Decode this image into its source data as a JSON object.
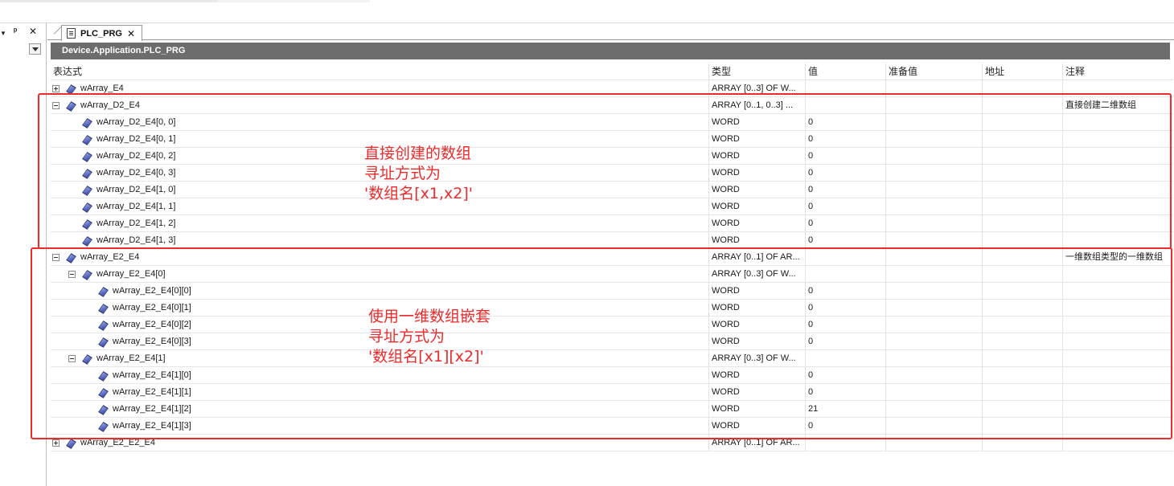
{
  "tab": {
    "title": "PLC_PRG",
    "close": "✕"
  },
  "path_header": "Device.Application.PLC_PRG",
  "columns": {
    "expression": "表达式",
    "type": "类型",
    "value": "值",
    "prepared_value": "准备值",
    "address": "地址",
    "comment": "注释"
  },
  "rows": [
    {
      "expr": "wArray_E4",
      "type": "ARRAY [0..3] OF W...",
      "value": "",
      "comment": "",
      "toggle": "plus"
    },
    {
      "expr": "wArray_D2_E4",
      "type": "ARRAY [0..1, 0..3] ...",
      "value": "",
      "comment": "直接创建二维数组",
      "toggle": "minus"
    },
    {
      "expr": "wArray_D2_E4[0, 0]",
      "type": "WORD",
      "value": "0",
      "comment": ""
    },
    {
      "expr": "wArray_D2_E4[0, 1]",
      "type": "WORD",
      "value": "0",
      "comment": ""
    },
    {
      "expr": "wArray_D2_E4[0, 2]",
      "type": "WORD",
      "value": "0",
      "comment": ""
    },
    {
      "expr": "wArray_D2_E4[0, 3]",
      "type": "WORD",
      "value": "0",
      "comment": ""
    },
    {
      "expr": "wArray_D2_E4[1, 0]",
      "type": "WORD",
      "value": "0",
      "comment": ""
    },
    {
      "expr": "wArray_D2_E4[1, 1]",
      "type": "WORD",
      "value": "0",
      "comment": ""
    },
    {
      "expr": "wArray_D2_E4[1, 2]",
      "type": "WORD",
      "value": "0",
      "comment": ""
    },
    {
      "expr": "wArray_D2_E4[1, 3]",
      "type": "WORD",
      "value": "0",
      "comment": ""
    },
    {
      "expr": "wArray_E2_E4",
      "type": "ARRAY [0..1] OF AR...",
      "value": "",
      "comment": "一维数组类型的一维数组",
      "toggle": "minus"
    },
    {
      "expr": "wArray_E2_E4[0]",
      "type": "ARRAY [0..3] OF W...",
      "value": "",
      "comment": "",
      "toggle": "minus"
    },
    {
      "expr": "wArray_E2_E4[0][0]",
      "type": "WORD",
      "value": "0",
      "comment": ""
    },
    {
      "expr": "wArray_E2_E4[0][1]",
      "type": "WORD",
      "value": "0",
      "comment": ""
    },
    {
      "expr": "wArray_E2_E4[0][2]",
      "type": "WORD",
      "value": "0",
      "comment": ""
    },
    {
      "expr": "wArray_E2_E4[0][3]",
      "type": "WORD",
      "value": "0",
      "comment": ""
    },
    {
      "expr": "wArray_E2_E4[1]",
      "type": "ARRAY [0..3] OF W...",
      "value": "",
      "comment": "",
      "toggle": "minus"
    },
    {
      "expr": "wArray_E2_E4[1][0]",
      "type": "WORD",
      "value": "0",
      "comment": ""
    },
    {
      "expr": "wArray_E2_E4[1][1]",
      "type": "WORD",
      "value": "0",
      "comment": ""
    },
    {
      "expr": "wArray_E2_E4[1][2]",
      "type": "WORD",
      "value": "21",
      "comment": ""
    },
    {
      "expr": "wArray_E2_E4[1][3]",
      "type": "WORD",
      "value": "0",
      "comment": ""
    },
    {
      "expr": "wArray_E2_E2_E4",
      "type": "ARRAY [0..1] OF AR...",
      "value": "",
      "comment": "",
      "toggle": "plus"
    }
  ],
  "annotations": {
    "direct": [
      "直接创建的数组",
      "寻址方式为",
      "'数组名[x1,x2]'"
    ],
    "nested": [
      "使用一维数组嵌套",
      "寻址方式为",
      "'数组名[x1][x2]'"
    ]
  },
  "colors": {
    "callout": "#ee2b2b",
    "header_bar": "#6d6d6d"
  }
}
